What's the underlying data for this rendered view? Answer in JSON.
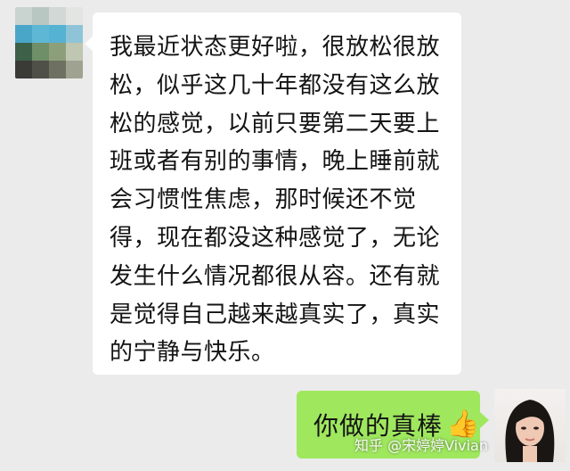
{
  "chat": {
    "incoming": {
      "text": "我最近状态更好啦，很放松很放松，似乎这几十年都没有这么放松的感觉，以前只要第二天要上班或者有别的事情，晚上睡前就会习惯性焦虑，那时候还不觉得，现在都没这种感觉了，无论发生什么情况都很从容。还有就是觉得自己越来越真实了，真实的宁静与快乐。",
      "avatar_icon": "blurred-avatar-icon"
    },
    "outgoing": {
      "text": "你做的真棒",
      "emoji": "👍",
      "avatar_icon": "woman-portrait-avatar-icon"
    }
  },
  "watermark": {
    "text": "知乎 @宋婷婷Vivian"
  },
  "colors": {
    "background": "#ebebeb",
    "incoming_bubble": "#ffffff",
    "outgoing_bubble": "#9fe85e",
    "text": "#141414"
  }
}
